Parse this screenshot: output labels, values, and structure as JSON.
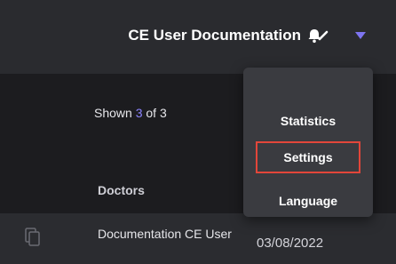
{
  "header": {
    "workspace_title": "CE User Documentation",
    "icons": [
      "chevron-down-icon",
      "bell-icon",
      "caret-down-icon"
    ]
  },
  "summary": {
    "prefix": "Shown",
    "shown": "3",
    "of_label": "of 3"
  },
  "table": {
    "columns": [
      "Doctors"
    ],
    "rows": [
      {
        "doctor": "Documentation CE User",
        "date": "03/08/2022"
      }
    ]
  },
  "user_menu": {
    "items": [
      {
        "label": "Statistics"
      },
      {
        "label": "Settings"
      },
      {
        "label": "Language"
      }
    ],
    "highlighted": "Settings"
  },
  "colors": {
    "accent": "#8c84ff",
    "highlight_border": "#e2463a",
    "topbar": "#2a2b2f",
    "menu_bg": "#3a3b40"
  }
}
